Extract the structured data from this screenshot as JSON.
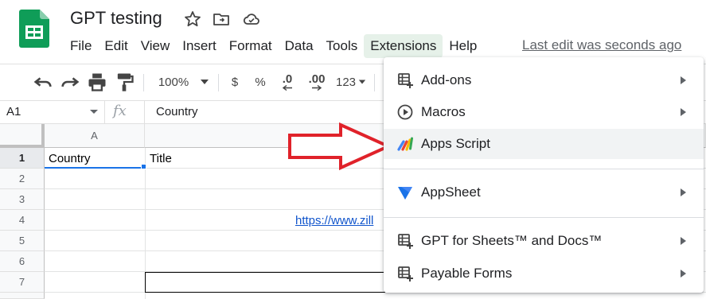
{
  "app": {
    "doc_title": "GPT testing",
    "last_edit": "Last edit was seconds ago",
    "brand_color": "#0f9d58"
  },
  "menu": [
    "File",
    "Edit",
    "View",
    "Insert",
    "Format",
    "Data",
    "Tools",
    "Extensions",
    "Help"
  ],
  "toolbar": {
    "zoom": "100%",
    "currency": "$",
    "percent": "%",
    "decrease_decimal": ".0",
    "increase_decimal": ".00",
    "more_formats": "123"
  },
  "formula_bar": {
    "cell_ref": "A1",
    "fx": "fx",
    "value": "Country"
  },
  "grid": {
    "columns": [
      "A"
    ],
    "rows": [
      "1",
      "2",
      "3",
      "4",
      "5",
      "6",
      "7"
    ],
    "cells": {
      "a1": "Country",
      "b1": "Title",
      "link_row4": "https://www.zill"
    }
  },
  "extensions_menu": {
    "items": [
      {
        "label": "Add-ons",
        "icon": "add-ons-icon",
        "submenu": true
      },
      {
        "label": "Macros",
        "icon": "play-circle-icon",
        "submenu": true
      },
      {
        "label": "Apps Script",
        "icon": "apps-script-icon",
        "submenu": false
      },
      {
        "label": "AppSheet",
        "icon": "appsheet-icon",
        "submenu": true
      },
      {
        "label": "GPT for Sheets™ and Docs™",
        "icon": "add-ons-icon",
        "submenu": true
      },
      {
        "label": "Payable Forms",
        "icon": "add-ons-icon",
        "submenu": true
      }
    ]
  },
  "annotation": {
    "arrow_color": "#e0222a"
  }
}
